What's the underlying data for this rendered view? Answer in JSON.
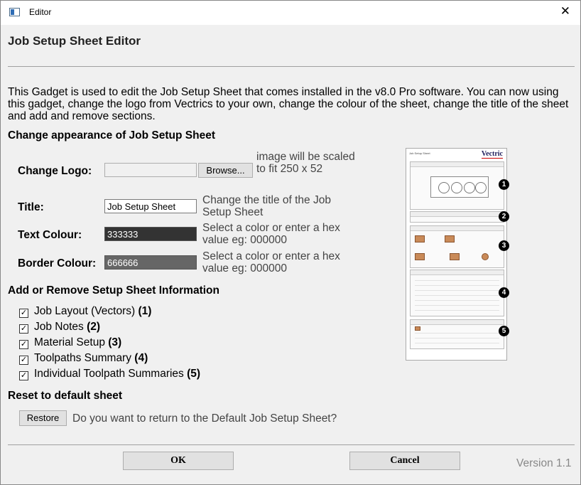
{
  "window": {
    "title": "Editor",
    "close_glyph": "✕"
  },
  "heading": "Job Setup Sheet Editor",
  "intro": "This Gadget is used to edit the Job Setup Sheet that comes installed in the v8.0 Pro software. You can now using this gadget, change the logo from Vectrics to your own, change the colour of the sheet, change the title of the sheet and add and remove sections.",
  "appearance": {
    "section_title": "Change appearance of Job Setup Sheet",
    "logo": {
      "label": "Change Logo:",
      "value": "",
      "browse_label": "Browse...",
      "hint": "image will be scaled to fit 250 x 52"
    },
    "title": {
      "label": "Title:",
      "value": "Job Setup Sheet",
      "hint": "Change the title of the Job Setup Sheet"
    },
    "text_colour": {
      "label": "Text Colour:",
      "value": "333333",
      "hint": "Select a color or enter a hex value eg: 000000",
      "color": "#333333"
    },
    "border_colour": {
      "label": "Border Colour:",
      "value": "666666",
      "hint": "Select a color or enter a hex value eg: 000000",
      "color": "#666666"
    }
  },
  "sections": {
    "section_title": "Add or Remove Setup Sheet Information",
    "items": [
      {
        "label": "Job Layout (Vectors)",
        "num": "(1)",
        "checked": true
      },
      {
        "label": "Job Notes",
        "num": "(2)",
        "checked": true
      },
      {
        "label": "Material Setup",
        "num": "(3)",
        "checked": true
      },
      {
        "label": "Toolpaths Summary",
        "num": "(4)",
        "checked": true
      },
      {
        "label": "Individual Toolpath Summaries",
        "num": "(5)",
        "checked": true
      }
    ]
  },
  "reset": {
    "section_title": "Reset to default sheet",
    "restore_label": "Restore",
    "question": "Do you want to return to the Default Job Setup Sheet?"
  },
  "footer": {
    "ok_label": "OK",
    "cancel_label": "Cancel",
    "version": "Version 1.1"
  },
  "preview": {
    "title": "Job Setup Sheet",
    "logo": "Vectric",
    "markers": [
      "1",
      "2",
      "3",
      "4",
      "5"
    ]
  }
}
